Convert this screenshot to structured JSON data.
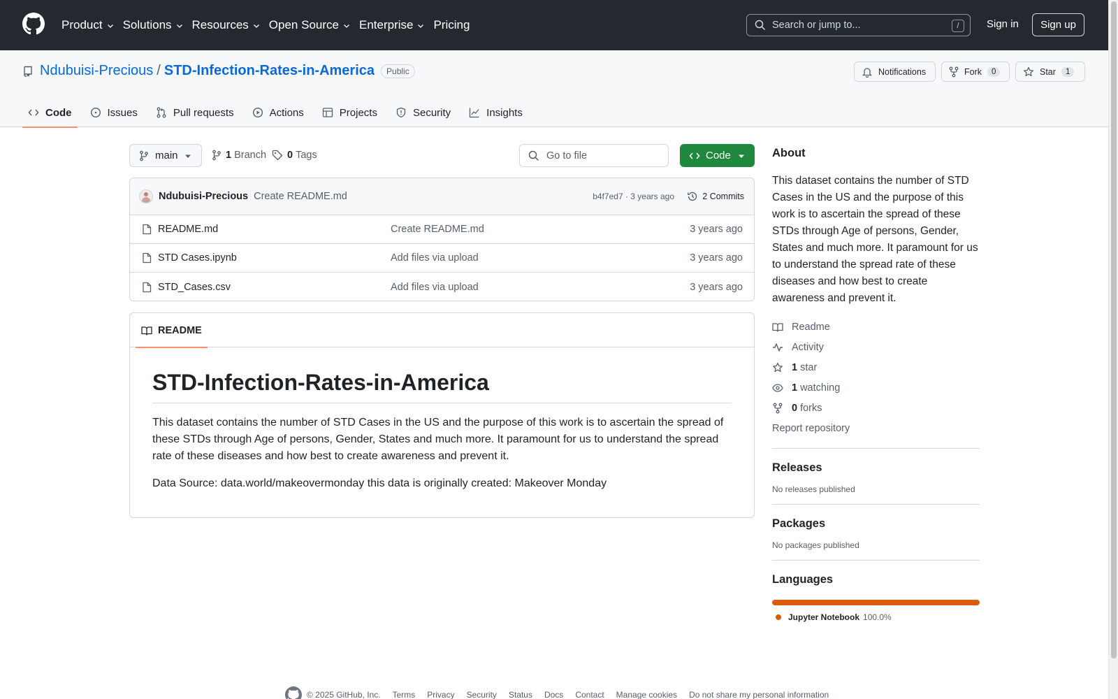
{
  "header": {
    "nav": [
      {
        "label": "Product",
        "dropdown": true
      },
      {
        "label": "Solutions",
        "dropdown": true
      },
      {
        "label": "Resources",
        "dropdown": true
      },
      {
        "label": "Open Source",
        "dropdown": true
      },
      {
        "label": "Enterprise",
        "dropdown": true
      },
      {
        "label": "Pricing",
        "dropdown": false
      }
    ],
    "search_placeholder": "Search or jump to...",
    "search_shortcut": "/",
    "sign_in": "Sign in",
    "sign_up": "Sign up"
  },
  "repo": {
    "owner": "Ndubuisi-Precious",
    "separator": "/",
    "name": "STD-Infection-Rates-in-America",
    "visibility": "Public",
    "notifications_label": "Notifications",
    "fork_label": "Fork",
    "fork_count": "0",
    "star_label": "Star",
    "star_count": "1"
  },
  "tabs": [
    {
      "label": "Code",
      "icon": "code-icon",
      "active": true
    },
    {
      "label": "Issues",
      "icon": "issue-icon",
      "active": false
    },
    {
      "label": "Pull requests",
      "icon": "pull-request-icon",
      "active": false
    },
    {
      "label": "Actions",
      "icon": "play-icon",
      "active": false
    },
    {
      "label": "Projects",
      "icon": "table-icon",
      "active": false
    },
    {
      "label": "Security",
      "icon": "shield-icon",
      "active": false
    },
    {
      "label": "Insights",
      "icon": "graph-icon",
      "active": false
    }
  ],
  "toolbar": {
    "branch": "main",
    "branch_count": "1",
    "branch_label": "Branch",
    "tag_count": "0",
    "tag_label": "Tags",
    "goto_placeholder": "Go to file",
    "code_button": "Code"
  },
  "commit": {
    "author": "Ndubuisi-Precious",
    "message": "Create README.md",
    "meta": "b4f7ed7 · 3 years ago",
    "commits": "2 Commits"
  },
  "files": [
    {
      "name": "README.md",
      "message": "Create README.md",
      "age": "3 years ago"
    },
    {
      "name": "STD Cases.ipynb",
      "message": "Add files via upload",
      "age": "3 years ago"
    },
    {
      "name": "STD_Cases.csv",
      "message": "Add files via upload",
      "age": "3 years ago"
    }
  ],
  "readme": {
    "tab_label": "README",
    "title": "STD-Infection-Rates-in-America",
    "paragraph1": "This dataset contains the number of STD Cases in the US and the purpose of this work is to ascertain the spread of these STDs through Age of persons, Gender, States and much more. It paramount for us to understand the spread rate of these diseases and how best to create awareness and prevent it.",
    "paragraph2": "Data Source: data.world/makeovermonday this data is originally created: Makeover Monday"
  },
  "sidebar": {
    "about_title": "About",
    "about_text": "This dataset contains the number of STD Cases in the US and the purpose of this work is to ascertain the spread of these STDs through Age of persons, Gender, States and much more. It paramount for us to understand the spread rate of these diseases and how best to create awareness and prevent it.",
    "readme_link": "Readme",
    "activity_link": "Activity",
    "stars_count": "1",
    "stars_label": "star",
    "watching_count": "1",
    "watching_label": "watching",
    "forks_count": "0",
    "forks_label": "forks",
    "report_link": "Report repository",
    "releases_title": "Releases",
    "releases_text": "No releases published",
    "packages_title": "Packages",
    "packages_text": "No packages published",
    "languages_title": "Languages",
    "language_name": "Jupyter Notebook",
    "language_pct": "100.0%",
    "language_color": "#da5b0b"
  },
  "footer": {
    "copyright": "© 2025 GitHub, Inc.",
    "links": [
      "Terms",
      "Privacy",
      "Security",
      "Status",
      "Docs",
      "Contact",
      "Manage cookies",
      "Do not share my personal information"
    ]
  },
  "colors": {
    "header_bg": "#24292f",
    "link": "#0969da",
    "primary_button": "#1f883d",
    "active_tab_underline": "#fd8c73"
  }
}
